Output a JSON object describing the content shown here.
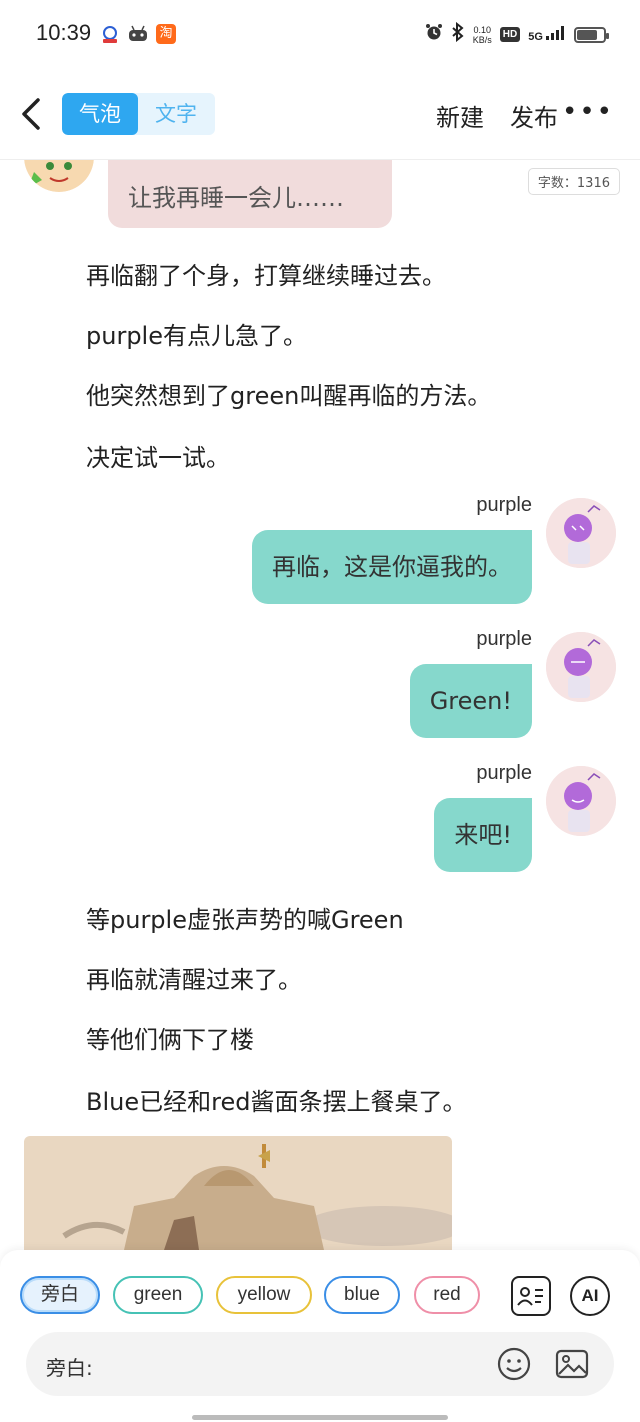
{
  "status_bar": {
    "time": "10:39",
    "app_icons": [
      "baidu-icon",
      "game-icon",
      "taobao-icon"
    ],
    "app_taobao_glyph": "淘",
    "net_speed_value": "0.10",
    "net_speed_unit": "KB/s",
    "hd_label": "HD",
    "signal_label": "5G",
    "battery_level": 0.75
  },
  "nav": {
    "mode_tabs": [
      {
        "label": "气泡",
        "active": true
      },
      {
        "label": "文字",
        "active": false
      }
    ],
    "new_label": "新建",
    "publish_label": "发布",
    "more_label": "•••"
  },
  "content": {
    "word_count": "字数：1316",
    "pink_bubble_text": "让我再睡一会儿……",
    "narration_1": [
      "再临翻了个身，打算继续睡过去。",
      "purple有点儿急了。",
      "他突然想到了green叫醒再临的方法。",
      "决定试一试。"
    ],
    "messages": [
      {
        "name": "purple",
        "text": "再临，这是你逼我的。"
      },
      {
        "name": "purple",
        "text": "Green!"
      },
      {
        "name": "purple",
        "text": "来吧!"
      }
    ],
    "narration_2": [
      "等purple虚张声势的喊Green",
      "再临就清醒过来了。",
      "等他们俩下了楼",
      "Blue已经和red酱面条摆上餐桌了。"
    ]
  },
  "composer": {
    "roles": [
      {
        "label": "旁白",
        "color": "#3a8ee6",
        "selected": true
      },
      {
        "label": "green",
        "color": "#46c2b5",
        "selected": false
      },
      {
        "label": "yellow",
        "color": "#e8c23a",
        "selected": false
      },
      {
        "label": "blue",
        "color": "#3a8ee6",
        "selected": false
      },
      {
        "label": "red",
        "color": "#ef8fa8",
        "selected": false
      }
    ],
    "contact_card_icon": "contact-card-icon",
    "ai_label": "AI",
    "input_prefix": "旁白:",
    "input_value": "",
    "emoji_icon": "smiley-icon",
    "image_icon": "image-icon"
  },
  "colors": {
    "accent": "#2ea7f0",
    "teal_bubble": "#86d8cc",
    "pink_bubble": "#f1dcdc"
  }
}
